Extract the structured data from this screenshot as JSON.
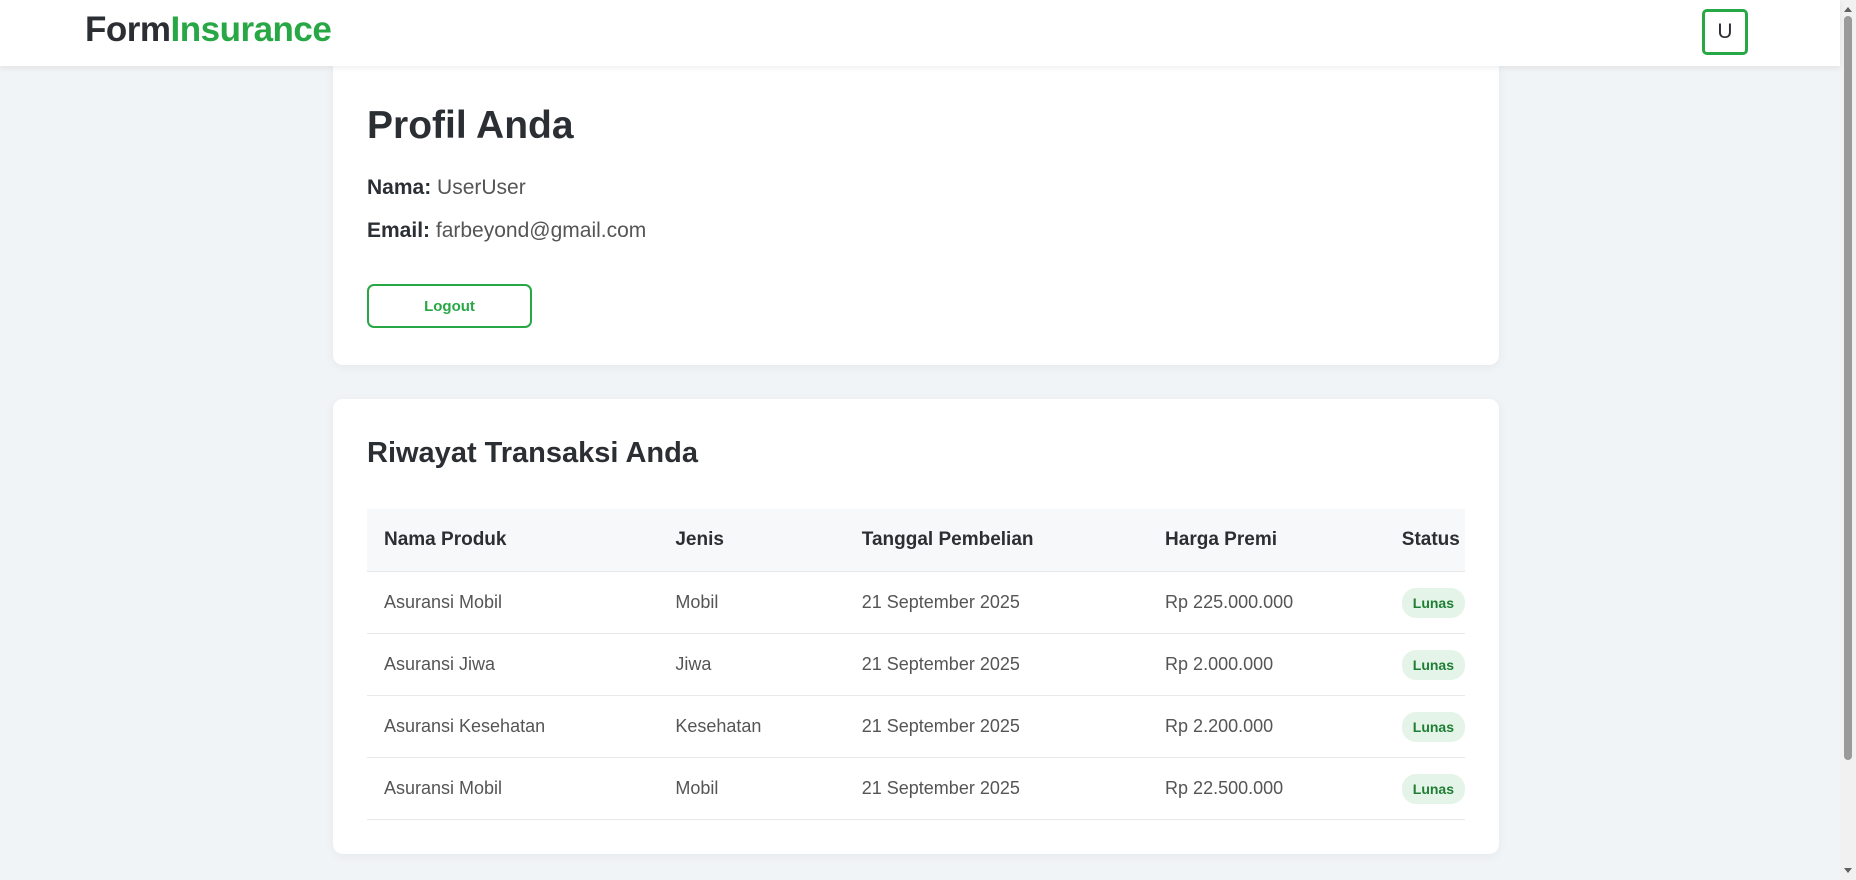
{
  "navbar": {
    "brand_part1": "Form",
    "brand_part2": "Insurance",
    "avatar_initial": "U"
  },
  "profile": {
    "title": "Profil Anda",
    "name_label": "Nama:",
    "name_value": "UserUser",
    "email_label": "Email:",
    "email_value": "farbeyond@gmail.com",
    "logout_label": "Logout"
  },
  "history": {
    "title": "Riwayat Transaksi Anda",
    "columns": [
      "Nama Produk",
      "Jenis",
      "Tanggal Pembelian",
      "Harga Premi",
      "Status"
    ],
    "rows": [
      {
        "product": "Asuransi Mobil",
        "type": "Mobil",
        "date": "21 September 2025",
        "premium": "Rp 225.000.000",
        "status": "Lunas"
      },
      {
        "product": "Asuransi Jiwa",
        "type": "Jiwa",
        "date": "21 September 2025",
        "premium": "Rp 2.000.000",
        "status": "Lunas"
      },
      {
        "product": "Asuransi Kesehatan",
        "type": "Kesehatan",
        "date": "21 September 2025",
        "premium": "Rp 2.200.000",
        "status": "Lunas"
      },
      {
        "product": "Asuransi Mobil",
        "type": "Mobil",
        "date": "21 September 2025",
        "premium": "Rp 22.500.000",
        "status": "Lunas"
      }
    ]
  },
  "colors": {
    "accent": "#28a745",
    "badge_bg": "#e5f4e8",
    "badge_text": "#1e7e34",
    "page_bg": "#f1f4f6"
  },
  "icons": {
    "scroll_up": "chevron-up-icon",
    "scroll_down": "chevron-down-icon"
  }
}
